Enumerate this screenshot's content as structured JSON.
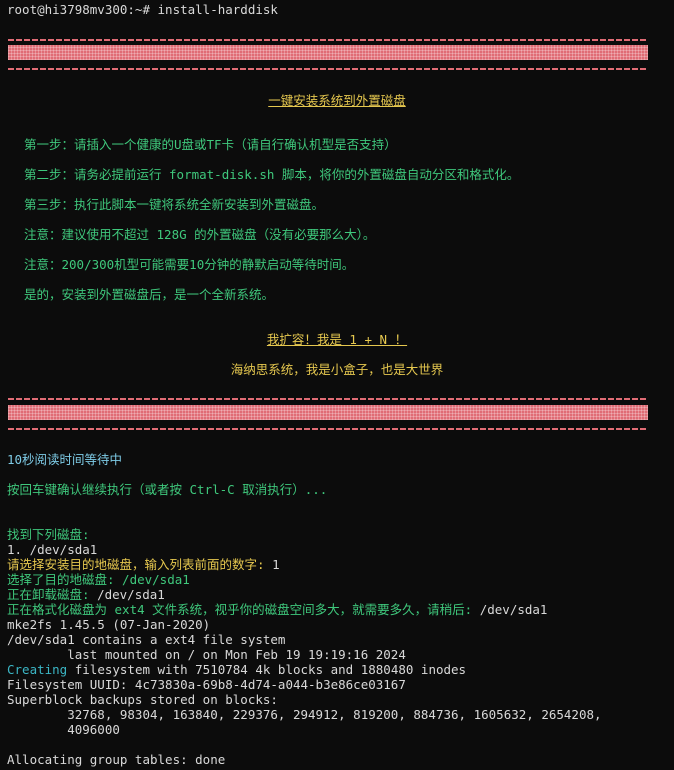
{
  "prompt": "root@hi3798mv300:~# install-harddisk",
  "banner": {
    "title": "一键安装系统到外置磁盘",
    "steps": [
      "第一步：请插入一个健康的U盘或TF卡（请自行确认机型是否支持）",
      "第二步：请务必提前运行 format-disk.sh 脚本，将你的外置磁盘自动分区和格式化。",
      "第三步：执行此脚本一键将系统全新安装到外置磁盘。",
      "注意：建议使用不超过 128G 的外置磁盘（没有必要那么大）。",
      "注意：200/300机型可能需要10分钟的静默启动等待时间。",
      "是的，安装到外置磁盘后，是一个全新系统。"
    ],
    "slogan": "我扩容！我是 1 + N ！",
    "tagline": "海纳思系统，我是小盒子，也是大世界"
  },
  "wait": {
    "countdown": "10秒阅读时间等待中",
    "confirm": "按回车键确认继续执行（或者按 Ctrl-C 取消执行）..."
  },
  "output": {
    "found": "找到下列磁盘:",
    "disk1": "1. /dev/sda1",
    "choose_prompt": "请选择安装目的地磁盘，输入列表前面的数字: ",
    "choose_value": "1",
    "selected_label": "选择了目的地磁盘: /dev/sda1",
    "unmount_label": "正在卸载磁盘: ",
    "unmount_value": "/dev/sda1",
    "format_label": "正在格式化磁盘为 ext4 文件系统，视乎你的磁盘空间多大，就需要多久，请稍后: ",
    "format_value": "/dev/sda1",
    "mke2fs": "mke2fs 1.45.5 (07-Jan-2020)",
    "contains": "/dev/sda1 contains a ext4 file system",
    "last_mounted": "        last mounted on / on Mon Feb 19 19:19:16 2024",
    "creating_word": "Creating",
    "creating_rest": " filesystem with 7510784 4k blocks and 1880480 inodes",
    "uuid": "Filesystem UUID: 4c73830a-69b8-4d74-a044-b3e86ce03167",
    "superblock": "Superblock backups stored on blocks:",
    "blocks1": "        32768, 98304, 163840, 229376, 294912, 819200, 884736, 1605632, 2654208,",
    "blocks2": "        4096000",
    "allocating": "Allocating group tables: done"
  },
  "colors": {
    "background": "#0c0c0c",
    "banner_red": "#e06c75",
    "green": "#3fc87c",
    "yellow": "#e6c84f",
    "cyan": "#3bb6c5"
  }
}
